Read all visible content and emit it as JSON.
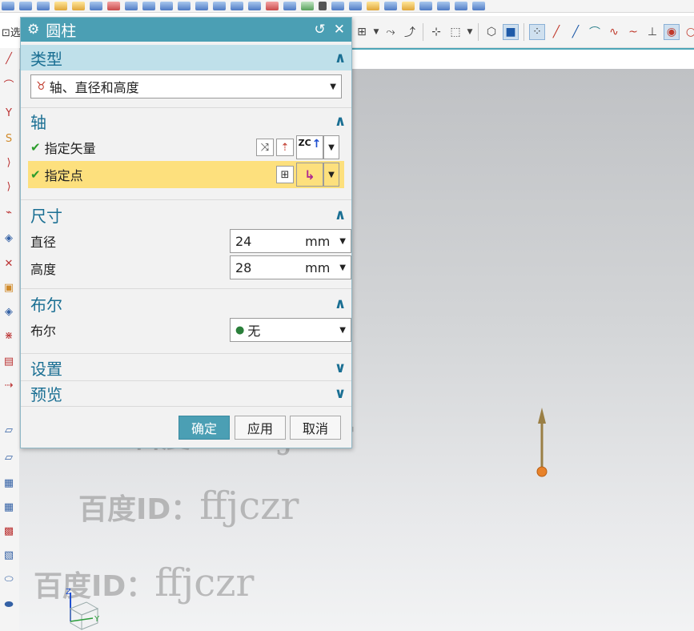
{
  "app": {
    "left_label": "⊡选",
    "watermark_cn": "百度ID：",
    "watermark_id": "ffjczr",
    "triad_z": "Z",
    "triad_y": "Y"
  },
  "dialog": {
    "title": "圆柱",
    "type_section": {
      "label": "类型",
      "selected": "轴、直径和高度"
    },
    "axis_section": {
      "label": "轴",
      "specify_vector": "指定矢量",
      "specify_point": "指定点",
      "vector_tag": "ZC"
    },
    "dimension_section": {
      "label": "尺寸",
      "diameter_label": "直径",
      "diameter_value": "24",
      "height_label": "高度",
      "height_value": "28",
      "unit": "mm"
    },
    "boolean_section": {
      "label": "布尔",
      "boolean_label": "布尔",
      "boolean_value": "无"
    },
    "settings_section": {
      "label": "设置"
    },
    "preview_section": {
      "label": "预览"
    },
    "buttons": {
      "ok": "确定",
      "apply": "应用",
      "cancel": "取消"
    }
  },
  "colors": {
    "title_bar": "#4b9fb4",
    "section_text": "#1a6f93",
    "highlight_row": "#fde07d",
    "check": "#2c9d2c"
  }
}
